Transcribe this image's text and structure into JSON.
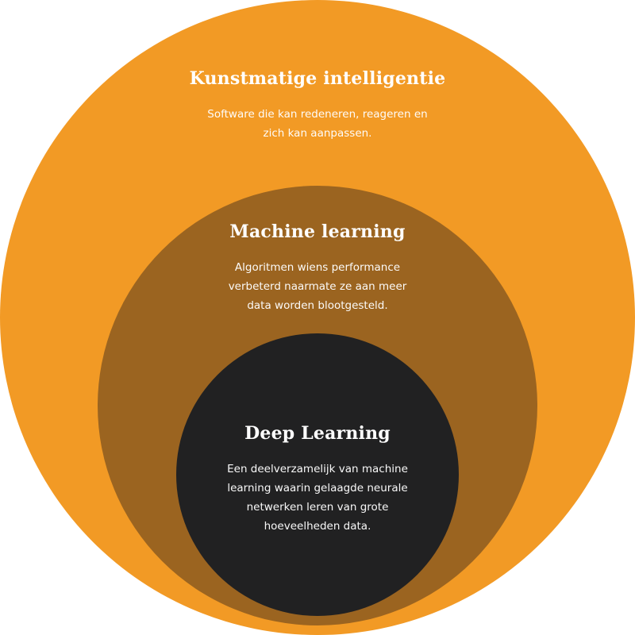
{
  "colors": {
    "outer": "#f29a25",
    "middle": "#9b6420",
    "inner": "#212122",
    "text": "#ffffff"
  },
  "diagram": {
    "outer": {
      "title": "Kunstmatige intelligentie",
      "description": "Software die kan redeneren, reageren en zich kan aanpassen."
    },
    "middle": {
      "title": "Machine learning",
      "description": "Algoritmen wiens performance verbeterd naarmate ze aan meer data worden blootgesteld."
    },
    "inner": {
      "title": "Deep Learning",
      "description": "Een deelverzamelijk van machine learning waarin gelaagde neurale netwerken leren van grote hoeveelheden data."
    }
  }
}
